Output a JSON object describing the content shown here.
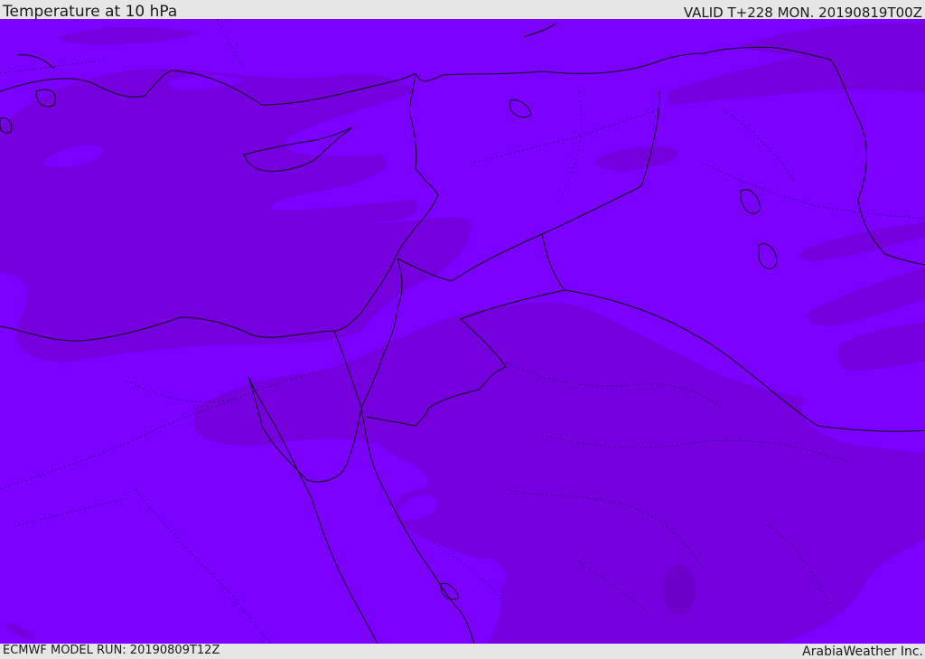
{
  "header": {
    "title": "Temperature at 10 hPa",
    "valid": "VALID T+228 MON. 20190819T00Z"
  },
  "footer": {
    "model_run": "ECMWF MODEL RUN: 20190809T12Z",
    "credit": "ArabiaWeather Inc."
  },
  "map": {
    "colors": {
      "background_field": "#7a00ff",
      "warmer_field": "#7400de",
      "border_line": "#111111",
      "admin_line": "#2a0060"
    }
  }
}
